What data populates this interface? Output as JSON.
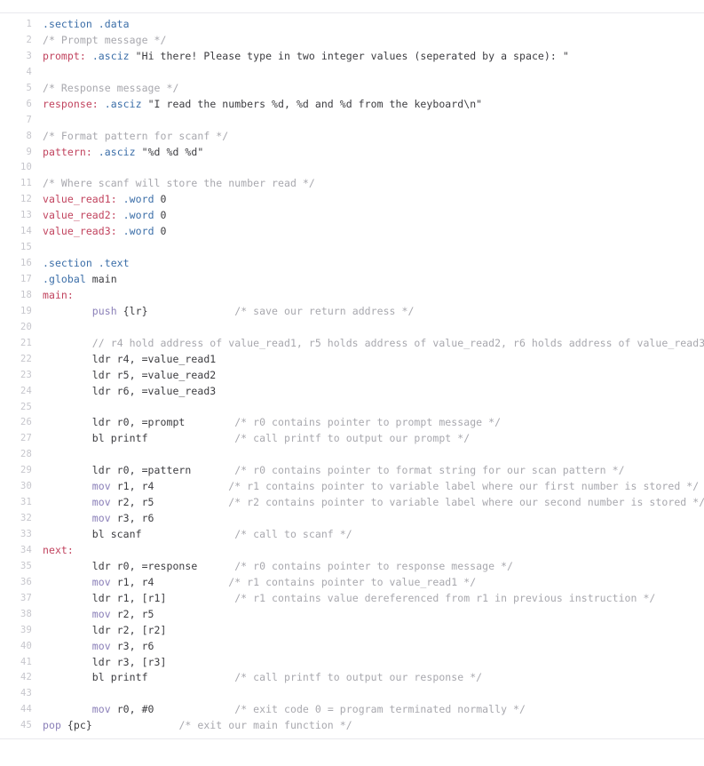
{
  "viewer": {
    "kind": "code-viewer",
    "language": "arm-assembly",
    "clipped_top_row": {
      "line_number": "",
      "text": "(       )"
    },
    "colors": {
      "background": "#ffffff",
      "rule": "#e9e9ed",
      "line_number": "#c6c6cc",
      "directive": "#3b6ea8",
      "label": "#c1435e",
      "comment": "#a8a8ae",
      "string": "#4a4a4f",
      "instruction": "#8a7fb8",
      "plain": "#3c3c40"
    },
    "total_lines": 45
  },
  "lines": [
    {
      "n": "1",
      "tokens": [
        {
          "t": ".section .data",
          "c": "tok-dir"
        }
      ]
    },
    {
      "n": "2",
      "tokens": [
        {
          "t": "/* Prompt message */",
          "c": "tok-cmt"
        }
      ]
    },
    {
      "n": "3",
      "tokens": [
        {
          "t": "prompt:",
          "c": "tok-label"
        },
        {
          "t": " ",
          "c": "tok-plain"
        },
        {
          "t": ".asciz",
          "c": "tok-dir"
        },
        {
          "t": " ",
          "c": "tok-plain"
        },
        {
          "t": "\"Hi there! Please type in two integer values (seperated by a space): \"",
          "c": "tok-str"
        }
      ]
    },
    {
      "n": "4",
      "tokens": []
    },
    {
      "n": "5",
      "tokens": [
        {
          "t": "/* Response message */",
          "c": "tok-cmt"
        }
      ]
    },
    {
      "n": "6",
      "tokens": [
        {
          "t": "response:",
          "c": "tok-label"
        },
        {
          "t": " ",
          "c": "tok-plain"
        },
        {
          "t": ".asciz",
          "c": "tok-dir"
        },
        {
          "t": " ",
          "c": "tok-plain"
        },
        {
          "t": "\"I read the numbers %d, %d and %d from the keyboard\\n\"",
          "c": "tok-str"
        }
      ]
    },
    {
      "n": "7",
      "tokens": []
    },
    {
      "n": "8",
      "tokens": [
        {
          "t": "/* Format pattern for scanf */",
          "c": "tok-cmt"
        }
      ]
    },
    {
      "n": "9",
      "tokens": [
        {
          "t": "pattern:",
          "c": "tok-label"
        },
        {
          "t": " ",
          "c": "tok-plain"
        },
        {
          "t": ".asciz",
          "c": "tok-dir"
        },
        {
          "t": " ",
          "c": "tok-plain"
        },
        {
          "t": "\"%d %d %d\"",
          "c": "tok-str"
        }
      ]
    },
    {
      "n": "10",
      "tokens": []
    },
    {
      "n": "11",
      "tokens": [
        {
          "t": "/* Where scanf will store the number read */",
          "c": "tok-cmt"
        }
      ]
    },
    {
      "n": "12",
      "tokens": [
        {
          "t": "value_read1:",
          "c": "tok-label"
        },
        {
          "t": " ",
          "c": "tok-plain"
        },
        {
          "t": ".word",
          "c": "tok-dir"
        },
        {
          "t": " 0",
          "c": "tok-num"
        }
      ]
    },
    {
      "n": "13",
      "tokens": [
        {
          "t": "value_read2:",
          "c": "tok-label"
        },
        {
          "t": " ",
          "c": "tok-plain"
        },
        {
          "t": ".word",
          "c": "tok-dir"
        },
        {
          "t": " 0",
          "c": "tok-num"
        }
      ]
    },
    {
      "n": "14",
      "tokens": [
        {
          "t": "value_read3:",
          "c": "tok-label"
        },
        {
          "t": " ",
          "c": "tok-plain"
        },
        {
          "t": ".word",
          "c": "tok-dir"
        },
        {
          "t": " 0",
          "c": "tok-num"
        }
      ]
    },
    {
      "n": "15",
      "tokens": []
    },
    {
      "n": "16",
      "tokens": [
        {
          "t": ".section .text",
          "c": "tok-dir"
        }
      ]
    },
    {
      "n": "17",
      "tokens": [
        {
          "t": ".global",
          "c": "tok-dir"
        },
        {
          "t": " main",
          "c": "tok-plain"
        }
      ]
    },
    {
      "n": "18",
      "tokens": [
        {
          "t": "main:",
          "c": "tok-label"
        }
      ]
    },
    {
      "n": "19",
      "tokens": [
        {
          "t": "        ",
          "c": "tok-plain"
        },
        {
          "t": "push",
          "c": "tok-instr"
        },
        {
          "t": " {lr}",
          "c": "tok-plain"
        },
        {
          "t": "              ",
          "c": "tok-plain"
        },
        {
          "t": "/* save our return address */",
          "c": "tok-cmt"
        }
      ]
    },
    {
      "n": "20",
      "tokens": []
    },
    {
      "n": "21",
      "tokens": [
        {
          "t": "        ",
          "c": "tok-plain"
        },
        {
          "t": "// r4 hold address of value_read1, r5 holds address of value_read2, r6 holds address of value_read3",
          "c": "tok-cmt"
        }
      ]
    },
    {
      "n": "22",
      "tokens": [
        {
          "t": "        ldr r4, =value_read1",
          "c": "tok-plain"
        }
      ]
    },
    {
      "n": "23",
      "tokens": [
        {
          "t": "        ldr r5, =value_read2",
          "c": "tok-plain"
        }
      ]
    },
    {
      "n": "24",
      "tokens": [
        {
          "t": "        ldr r6, =value_read3",
          "c": "tok-plain"
        }
      ]
    },
    {
      "n": "25",
      "tokens": []
    },
    {
      "n": "26",
      "tokens": [
        {
          "t": "        ldr r0, =prompt",
          "c": "tok-plain"
        },
        {
          "t": "        ",
          "c": "tok-plain"
        },
        {
          "t": "/* r0 contains pointer to prompt message */",
          "c": "tok-cmt"
        }
      ]
    },
    {
      "n": "27",
      "tokens": [
        {
          "t": "        bl printf",
          "c": "tok-plain"
        },
        {
          "t": "              ",
          "c": "tok-plain"
        },
        {
          "t": "/* call printf to output our prompt */",
          "c": "tok-cmt"
        }
      ]
    },
    {
      "n": "28",
      "tokens": []
    },
    {
      "n": "29",
      "tokens": [
        {
          "t": "        ldr r0, =pattern",
          "c": "tok-plain"
        },
        {
          "t": "       ",
          "c": "tok-plain"
        },
        {
          "t": "/* r0 contains pointer to format string for our scan pattern */",
          "c": "tok-cmt"
        }
      ]
    },
    {
      "n": "30",
      "tokens": [
        {
          "t": "        ",
          "c": "tok-plain"
        },
        {
          "t": "mov",
          "c": "tok-instr"
        },
        {
          "t": " r1, r4",
          "c": "tok-plain"
        },
        {
          "t": "            ",
          "c": "tok-plain"
        },
        {
          "t": "/* r1 contains pointer to variable label where our first number is stored */",
          "c": "tok-cmt"
        }
      ]
    },
    {
      "n": "31",
      "tokens": [
        {
          "t": "        ",
          "c": "tok-plain"
        },
        {
          "t": "mov",
          "c": "tok-instr"
        },
        {
          "t": " r2, r5",
          "c": "tok-plain"
        },
        {
          "t": "            ",
          "c": "tok-plain"
        },
        {
          "t": "/* r2 contains pointer to variable label where our second number is stored */",
          "c": "tok-cmt"
        }
      ]
    },
    {
      "n": "32",
      "tokens": [
        {
          "t": "        ",
          "c": "tok-plain"
        },
        {
          "t": "mov",
          "c": "tok-instr"
        },
        {
          "t": " r3, r6",
          "c": "tok-plain"
        }
      ]
    },
    {
      "n": "33",
      "tokens": [
        {
          "t": "        bl scanf",
          "c": "tok-plain"
        },
        {
          "t": "               ",
          "c": "tok-plain"
        },
        {
          "t": "/* call to scanf */",
          "c": "tok-cmt"
        }
      ]
    },
    {
      "n": "34",
      "tokens": [
        {
          "t": "next:",
          "c": "tok-label"
        }
      ]
    },
    {
      "n": "35",
      "tokens": [
        {
          "t": "        ldr r0, =response",
          "c": "tok-plain"
        },
        {
          "t": "      ",
          "c": "tok-plain"
        },
        {
          "t": "/* r0 contains pointer to response message */",
          "c": "tok-cmt"
        }
      ]
    },
    {
      "n": "36",
      "tokens": [
        {
          "t": "        ",
          "c": "tok-plain"
        },
        {
          "t": "mov",
          "c": "tok-instr"
        },
        {
          "t": " r1, r4",
          "c": "tok-plain"
        },
        {
          "t": "            ",
          "c": "tok-plain"
        },
        {
          "t": "/* r1 contains pointer to value_read1 */",
          "c": "tok-cmt"
        }
      ]
    },
    {
      "n": "37",
      "tokens": [
        {
          "t": "        ldr r1, [r1]",
          "c": "tok-plain"
        },
        {
          "t": "           ",
          "c": "tok-plain"
        },
        {
          "t": "/* r1 contains value dereferenced from r1 in previous instruction */",
          "c": "tok-cmt"
        }
      ]
    },
    {
      "n": "38",
      "tokens": [
        {
          "t": "        ",
          "c": "tok-plain"
        },
        {
          "t": "mov",
          "c": "tok-instr"
        },
        {
          "t": " r2, r5",
          "c": "tok-plain"
        }
      ]
    },
    {
      "n": "39",
      "tokens": [
        {
          "t": "        ldr r2, [r2]",
          "c": "tok-plain"
        }
      ]
    },
    {
      "n": "40",
      "tokens": [
        {
          "t": "        ",
          "c": "tok-plain"
        },
        {
          "t": "mov",
          "c": "tok-instr"
        },
        {
          "t": " r3, r6",
          "c": "tok-plain"
        }
      ]
    },
    {
      "n": "41",
      "tokens": [
        {
          "t": "        ldr r3, [r3]",
          "c": "tok-plain"
        }
      ]
    },
    {
      "n": "42",
      "tokens": [
        {
          "t": "        bl printf",
          "c": "tok-plain"
        },
        {
          "t": "              ",
          "c": "tok-plain"
        },
        {
          "t": "/* call printf to output our response */",
          "c": "tok-cmt"
        }
      ]
    },
    {
      "n": "43",
      "tokens": []
    },
    {
      "n": "44",
      "tokens": [
        {
          "t": "        ",
          "c": "tok-plain"
        },
        {
          "t": "mov",
          "c": "tok-instr"
        },
        {
          "t": " r0, #0",
          "c": "tok-plain"
        },
        {
          "t": "             ",
          "c": "tok-plain"
        },
        {
          "t": "/* exit code 0 = program terminated normally */",
          "c": "tok-cmt"
        }
      ]
    },
    {
      "n": "45",
      "tokens": [
        {
          "t": "pop",
          "c": "tok-instr"
        },
        {
          "t": " {pc}",
          "c": "tok-plain"
        },
        {
          "t": "              ",
          "c": "tok-plain"
        },
        {
          "t": "/* exit our main function */",
          "c": "tok-cmt"
        }
      ]
    }
  ]
}
